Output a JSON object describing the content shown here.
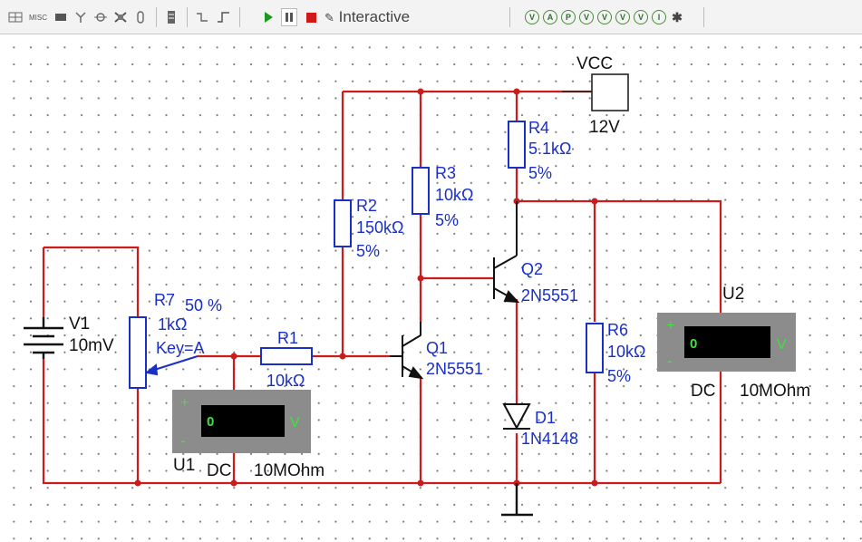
{
  "toolbar": {
    "misc_label": "MISC",
    "mode_label": "Interactive",
    "accent_play": "#1a9a1a",
    "accent_stop": "#d01818",
    "left_icons": [
      "grid-icon",
      "misc-icon",
      "chip-icon",
      "antenna-icon",
      "probe-icon",
      "connector-icon",
      "clip-icon",
      "list-icon",
      "wire-icon",
      "pulse-icon"
    ],
    "right_icons": [
      "v-probe-icon",
      "a-probe-icon",
      "p-probe-icon",
      "diff-probe-icon",
      "ref-probe-icon",
      "dc-probe-icon",
      "ac-probe-icon",
      "i-probe-icon",
      "settings-icon"
    ],
    "right_glyphs": [
      "V",
      "A",
      "P",
      "V",
      "V",
      "V",
      "V",
      "I",
      "✱"
    ]
  },
  "circuit": {
    "wire_color": "#cc1b1b",
    "component_color": "#1a2fc7",
    "vcc": {
      "name": "VCC",
      "value": "12V"
    },
    "v1": {
      "name": "V1",
      "value": "10mV"
    },
    "r7": {
      "name": "R7",
      "percent": "50 %",
      "value": "1kΩ",
      "key": "Key=A"
    },
    "r1": {
      "name": "R1",
      "value": "10kΩ"
    },
    "r2": {
      "name": "R2",
      "value": "150kΩ",
      "tol": "5%"
    },
    "r3": {
      "name": "R3",
      "value": "10kΩ",
      "tol": "5%"
    },
    "r4": {
      "name": "R4",
      "value": "5.1kΩ",
      "tol": "5%"
    },
    "r6": {
      "name": "R6",
      "value": "10kΩ",
      "tol": "5%"
    },
    "q1": {
      "name": "Q1",
      "model": "2N5551"
    },
    "q2": {
      "name": "Q2",
      "model": "2N5551"
    },
    "d1": {
      "name": "D1",
      "model": "1N4148"
    },
    "u1": {
      "name": "U1",
      "reading": "0",
      "unit": "V",
      "mode": "DC",
      "impedance": "10MOhm",
      "plus": "+",
      "minus": "-"
    },
    "u2": {
      "name": "U2",
      "reading": "0",
      "unit": "V",
      "mode": "DC",
      "impedance": "10MOhm",
      "plus": "+",
      "minus": "-"
    }
  }
}
